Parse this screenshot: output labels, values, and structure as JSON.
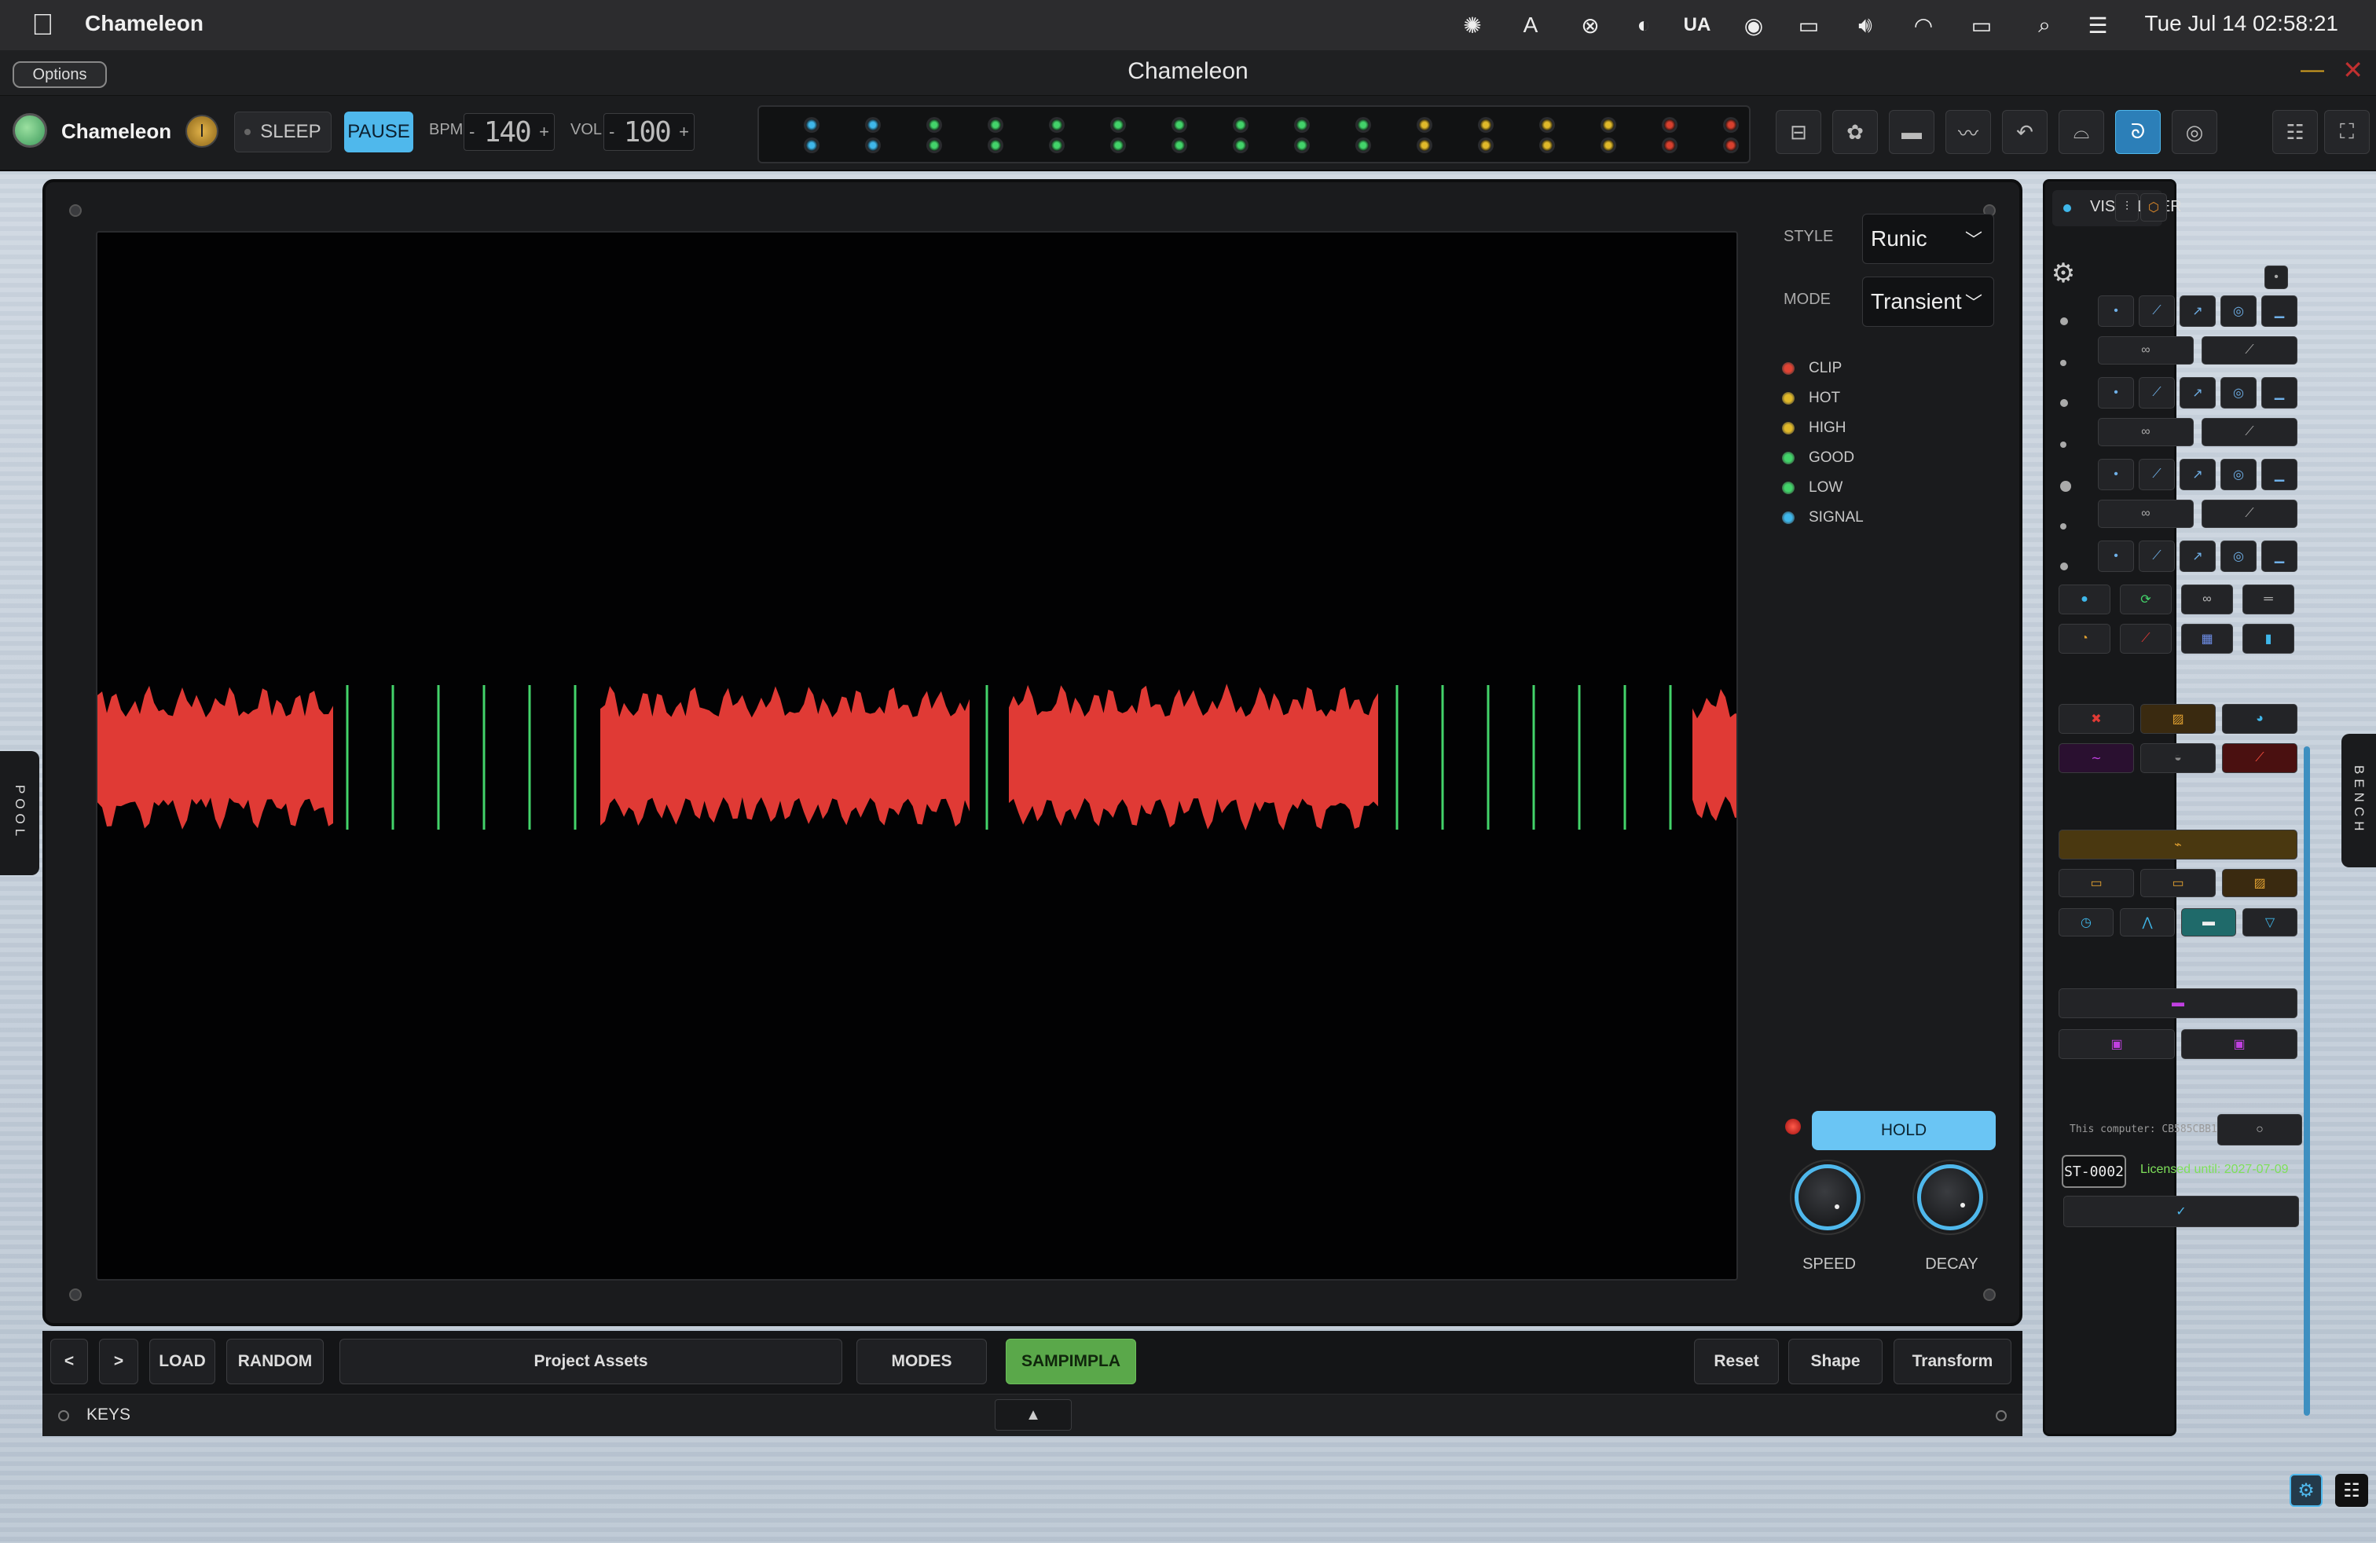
{
  "menubar": {
    "app_name": "Chameleon",
    "keyboard_layout": "UA",
    "clock": "Tue Jul 14  02:58:21"
  },
  "window": {
    "title": "Chameleon",
    "options_label": "Options"
  },
  "toolbar": {
    "brand": "Chameleon",
    "sleep_label": "SLEEP",
    "pause_label": "PAUSE",
    "bpm_label": "BPM",
    "bpm_value": "140",
    "vol_label": "VOL",
    "vol_value": "100",
    "minus": "-",
    "plus": "+",
    "meter_colors": [
      "#3fb7ea",
      "#3fb7ea",
      "#43d36a",
      "#43d36a",
      "#43d36a",
      "#43d36a",
      "#43d36a",
      "#43d36a",
      "#43d36a",
      "#43d36a",
      "#e0b92a",
      "#e0b92a",
      "#e0b92a",
      "#e0b92a",
      "#d8402e",
      "#d8402e"
    ]
  },
  "display": {
    "style_label": "STYLE",
    "style_value": "Runic",
    "mode_label": "MODE",
    "mode_value": "Transient",
    "levels": [
      {
        "label": "CLIP",
        "color": "#e04434"
      },
      {
        "label": "HOT",
        "color": "#e0b92a"
      },
      {
        "label": "HIGH",
        "color": "#e0b92a"
      },
      {
        "label": "GOOD",
        "color": "#43d36a"
      },
      {
        "label": "LOW",
        "color": "#43d36a"
      },
      {
        "label": "SIGNAL",
        "color": "#3fb7ea"
      }
    ],
    "hold_label": "HOLD",
    "speed_label": "SPEED",
    "decay_label": "DECAY",
    "waveform_color": "#e03a35",
    "marker_color": "#43d36a"
  },
  "bottombar": {
    "prev": "<",
    "next": ">",
    "load": "LOAD",
    "random": "RANDOM",
    "project_assets": "Project Assets",
    "modes": "MODES",
    "sampimpla": "SAMPIMPLA",
    "reset": "Reset",
    "shape": "Shape",
    "transform": "Transform"
  },
  "keys": {
    "label": "KEYS",
    "arrow": "▲"
  },
  "sidetabs": {
    "pool": "POOL",
    "bench": "BENCH"
  },
  "rightpanel": {
    "visualizer_label": "VISUALIZER",
    "machine_info": "This computer: CB585CBB1…",
    "license_code": "ST-0002",
    "licensed_until": "Licensed until: 2027-07-09",
    "confirm": "✓"
  }
}
